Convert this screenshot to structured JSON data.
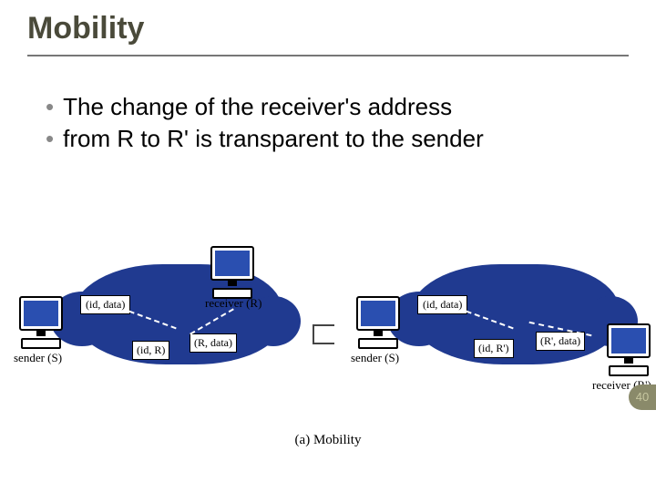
{
  "title": "Mobility",
  "bullets": [
    "The change of the receiver's address",
    "from R to R' is transparent to the sender"
  ],
  "caption": "(a) Mobility",
  "page_number": "40",
  "left": {
    "sender_label": "sender (S)",
    "receiver_label": "receiver (R)",
    "sent_pkt": "(id, data)",
    "net_pkt": "(id, R)",
    "deliv_pkt": "(R, data)"
  },
  "right": {
    "sender_label": "sender (S)",
    "receiver_label": "receiver (R')",
    "sent_pkt": "(id, data)",
    "net_pkt": "(id, R')",
    "deliv_pkt": "(R', data)"
  }
}
